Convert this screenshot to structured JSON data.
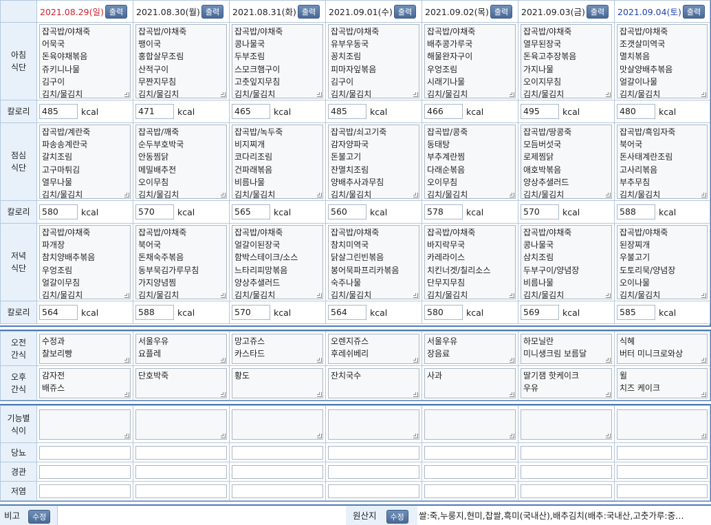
{
  "print_label": "출력",
  "edit_label": "수정",
  "days": [
    {
      "date": "2021.08.29(일)",
      "kind": "sun"
    },
    {
      "date": "2021.08.30(월)",
      "kind": "wd"
    },
    {
      "date": "2021.08.31(화)",
      "kind": "wd"
    },
    {
      "date": "2021.09.01(수)",
      "kind": "wd"
    },
    {
      "date": "2021.09.02(목)",
      "kind": "wd"
    },
    {
      "date": "2021.09.03(금)",
      "kind": "wd"
    },
    {
      "date": "2021.09.04(토)",
      "kind": "sat"
    }
  ],
  "labels": {
    "breakfast": [
      "아침",
      "식단"
    ],
    "lunch": [
      "점심",
      "식단"
    ],
    "dinner": [
      "저녁",
      "식단"
    ],
    "calorie": "칼로리",
    "am_snack": [
      "오전",
      "간식"
    ],
    "pm_snack": [
      "오후",
      "간식"
    ],
    "functional": [
      "기능별",
      "식이"
    ],
    "diabetes": "당뇨",
    "tube": "경관",
    "lowsalt": "저염",
    "remarks": "비고",
    "origin": "원산지"
  },
  "unit": "kcal",
  "breakfast": [
    [
      "잡곡밥/야채죽",
      "어묵국",
      "돈육야채볶음",
      "쥬키니나물",
      "김구이",
      "김치/물김치"
    ],
    [
      "잡곡밥/야채죽",
      "팽이국",
      "홍합살무조림",
      "산적구이",
      "무짠지무침",
      "김치/물김치"
    ],
    [
      "잡곡밥/야채죽",
      "콩나물국",
      "두부조림",
      "스모크햄구이",
      "고춧잎지무침",
      "김치/물김치"
    ],
    [
      "잡곡밥/야채죽",
      "유부우동국",
      "꽁치조림",
      "피마자잎볶음",
      "김구이",
      "김치/물김치"
    ],
    [
      "잡곡밥/야채죽",
      "배추콩가루국",
      "해물완자구이",
      "우엉조림",
      "시래기나물",
      "김치/물김치"
    ],
    [
      "잡곡밥/야채죽",
      "열무된장국",
      "돈육고추장볶음",
      "가지나물",
      "오이지무침",
      "김치/물김치"
    ],
    [
      "잡곡밥/야채죽",
      "조갯살미역국",
      "멸치볶음",
      "맛살양배추볶음",
      "얼갈이나물",
      "김치/물김치"
    ]
  ],
  "breakfast_kcal": [
    "485",
    "471",
    "465",
    "485",
    "466",
    "495",
    "480"
  ],
  "lunch": [
    [
      "잡곡밥/계란죽",
      "파송송계란국",
      "갈치조림",
      "고구마튀김",
      "열무나물",
      "김치/물김치"
    ],
    [
      "잡곡밥/깨죽",
      "순두부호박국",
      "안동찜닭",
      "메밀배추전",
      "오이무침",
      "김치/물김치"
    ],
    [
      "잡곡밥/녹두죽",
      "비지찌개",
      "코다리조림",
      "건파래볶음",
      "비름나물",
      "김치/물김치"
    ],
    [
      "잡곡밥/쇠고기죽",
      "감자양파국",
      "돈불고기",
      "잔멸치조림",
      "양배추사과무침",
      "김치/물김치"
    ],
    [
      "잡곡밥/콩죽",
      "동태탕",
      "부추계란찜",
      "다래순볶음",
      "오이무침",
      "김치/물김치"
    ],
    [
      "잡곡밥/땅콩죽",
      "모듬버섯국",
      "로제찜닭",
      "애호박볶음",
      "양상추샐러드",
      "김치/물김치"
    ],
    [
      "잡곡밥/흑임자죽",
      "북어국",
      "돈사태계란조림",
      "고사리볶음",
      "부추무침",
      "김치/물김치"
    ]
  ],
  "lunch_kcal": [
    "580",
    "570",
    "565",
    "560",
    "578",
    "570",
    "588"
  ],
  "dinner": [
    [
      "잡곡밥/야채죽",
      "파개장",
      "참치양배추볶음",
      "우엉조림",
      "얼갈이무침",
      "김치/물김치"
    ],
    [
      "잡곡밥/야채죽",
      "북어국",
      "돈채숙주볶음",
      "동부묵김가루무침",
      "가지양념찜",
      "김치/물김치"
    ],
    [
      "잡곡밥/야채죽",
      "얼갈이된장국",
      "함박스테이크/소스",
      "느타리피망볶음",
      "양상추샐러드",
      "김치/물김치"
    ],
    [
      "잡곡밥/야채죽",
      "참치미역국",
      "닭살그린빈볶음",
      "봉어묵파프리카볶음",
      "숙주나물",
      "김치/물김치"
    ],
    [
      "잡곡밥/야채죽",
      "바지락무국",
      "카레라이스",
      "치킨너겟/칠리소스",
      "단무지무침",
      "김치/물김치"
    ],
    [
      "잡곡밥/야채죽",
      "콩나물국",
      "삼치조림",
      "두부구이/양념장",
      "비름나물",
      "김치/물김치"
    ],
    [
      "잡곡밥/야채죽",
      "된장찌개",
      "우불고기",
      "도토리묵/양념장",
      "오이나물",
      "김치/물김치"
    ]
  ],
  "dinner_kcal": [
    "564",
    "588",
    "570",
    "564",
    "580",
    "569",
    "585"
  ],
  "am_snack": [
    [
      "수정과",
      "찰보리빵"
    ],
    [
      "서울우유",
      "요플레"
    ],
    [
      "망고쥬스",
      "카스타드"
    ],
    [
      "오렌지쥬스",
      "후레쉬베리"
    ],
    [
      "서울우유",
      "장음료"
    ],
    [
      "하모닐란",
      "미니생크림 보름달"
    ],
    [
      "식혜",
      "버터 미니크로와상"
    ]
  ],
  "pm_snack": [
    [
      "감자전",
      "배쥬스"
    ],
    [
      "단호박죽"
    ],
    [
      "황도"
    ],
    [
      "잔치국수"
    ],
    [
      "사과"
    ],
    [
      "딸기잼 핫케이크",
      "우유"
    ],
    [
      "윌",
      "치즈 케이크"
    ]
  ],
  "origin_text": "쌀:죽,누룽지,현미,찹쌀,흑미(국내산),배추김치(배추:국내산,고춧가루:중…"
}
